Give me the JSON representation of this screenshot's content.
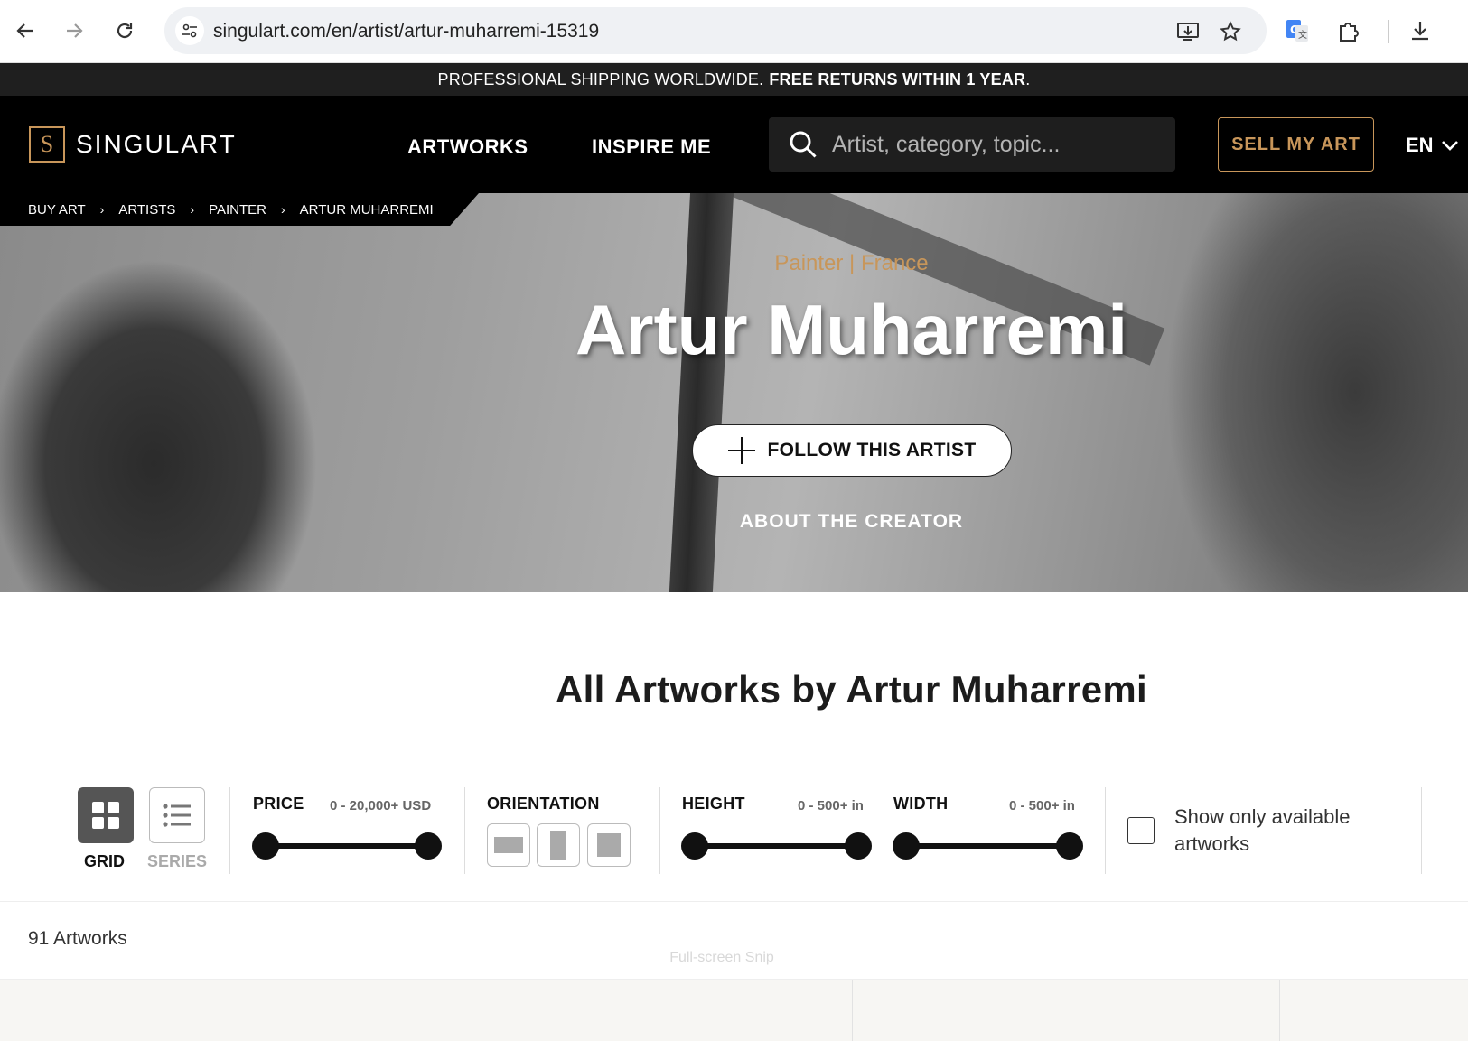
{
  "browser": {
    "url": "singulart.com/en/artist/artur-muharremi-15319",
    "icons": [
      "back-arrow-icon",
      "forward-arrow-icon",
      "reload-icon",
      "site-settings-icon",
      "install-app-icon",
      "bookmark-star-icon",
      "google-translate-icon",
      "extensions-puzzle-icon",
      "download-icon"
    ]
  },
  "promo": {
    "text": "PROFESSIONAL SHIPPING WORLDWIDE.",
    "bold": "FREE RETURNS WITHIN 1 YEAR",
    "end": "."
  },
  "header": {
    "logo_text": "SINGULART",
    "logo_mark": "S",
    "nav": [
      "ARTWORKS",
      "INSPIRE ME"
    ],
    "search_placeholder": "Artist, category, topic...",
    "sell_label": "SELL MY ART",
    "language": "EN"
  },
  "breadcrumb": [
    "BUY ART",
    "ARTISTS",
    "PAINTER",
    "ARTUR MUHARREMI"
  ],
  "hero": {
    "subtitle": "Painter | France",
    "name": "Artur Muharremi",
    "follow_label": "FOLLOW THIS ARTIST",
    "about_label": "ABOUT THE CREATOR"
  },
  "section": {
    "title": "All Artworks by Artur Muharremi"
  },
  "filters": {
    "view_grid": "GRID",
    "view_series": "SERIES",
    "price": {
      "title": "PRICE",
      "range": "0 - 20,000+ USD"
    },
    "orientation": {
      "title": "ORIENTATION"
    },
    "height": {
      "title": "HEIGHT",
      "range": "0 - 500+ in"
    },
    "width": {
      "title": "WIDTH",
      "range": "0 - 500+ in"
    },
    "available_label": "Show only available artworks"
  },
  "results": {
    "count": "91 Artworks",
    "overlay_hint": "Full-screen Snip"
  },
  "colors": {
    "accent_gold": "#c8965a",
    "header_bg": "#000000",
    "promo_bg": "#1f1f1f"
  }
}
